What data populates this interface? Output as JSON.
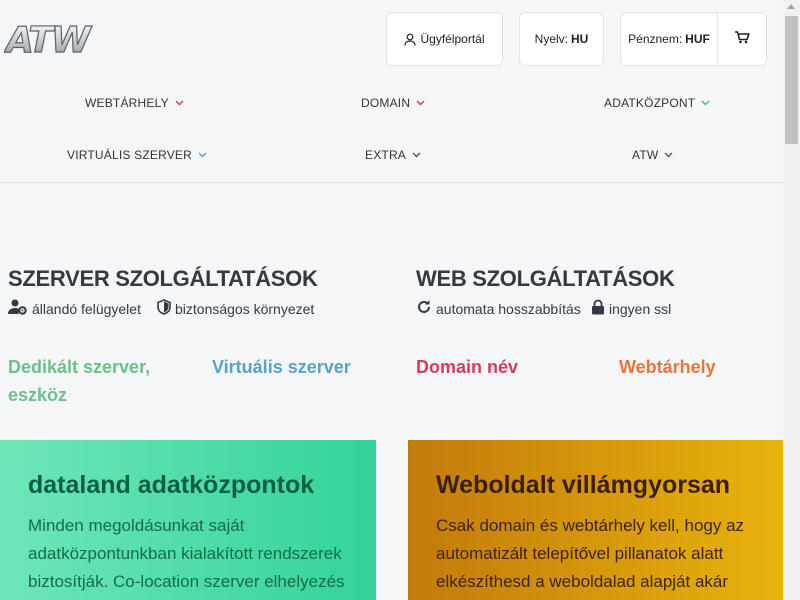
{
  "header": {
    "logo_text": "ATW",
    "portal_label": "Ügyfélportál",
    "language_label": "Nyelv:",
    "language_value": "HU",
    "currency_label": "Pénznem:",
    "currency_value": "HUF"
  },
  "nav": {
    "items": [
      {
        "label": "WEBTÁRHELY",
        "chevron_color": "#d63b5a"
      },
      {
        "label": "DOMAIN",
        "chevron_color": "#d63b5a"
      },
      {
        "label": "ADATKÖZPONT",
        "chevron_color": "#3fb98b"
      },
      {
        "label": "VIRTUÁLIS SZERVER",
        "chevron_color": "#5aa0c8"
      },
      {
        "label": "EXTRA",
        "chevron_color": "#555555"
      },
      {
        "label": "ATW",
        "chevron_color": "#555555"
      }
    ]
  },
  "server_services": {
    "title": "SZERVER SZOLGÁLTATÁSOK",
    "features": [
      {
        "icon": "user-gear-icon",
        "label": "állandó felügyelet"
      },
      {
        "icon": "shield-icon",
        "label": "biztonságos környezet"
      }
    ],
    "links": [
      {
        "label": "Dedikált szerver, eszköz",
        "color": "#6fbf8a"
      },
      {
        "label": "Virtuális szerver",
        "color": "#5aa0c8"
      }
    ]
  },
  "web_services": {
    "title": "WEB SZOLGÁLTATÁSOK",
    "features": [
      {
        "icon": "refresh-icon",
        "label": "automata hosszabbítás"
      },
      {
        "icon": "lock-icon",
        "label": "ingyen ssl"
      }
    ],
    "links": [
      {
        "label": "Domain név",
        "color": "#d63b5a"
      },
      {
        "label": "Webtárhely",
        "color": "#e8743b"
      }
    ]
  },
  "cards": {
    "datacenter": {
      "title": "dataland adatközpontok",
      "body": "Minden megoldásunkat saját adatközpontunkban kialakított rendszerek biztosítják. Co-location szerver elhelyezés"
    },
    "website": {
      "title": "Weboldalt villámgyorsan",
      "body": "Csak domain és webtárhely kell, hogy az automatizált telepítővel pillanatok alatt elkészíthesd a weboldalad alapját akár"
    }
  },
  "colors": {
    "accent_green": "#34d399",
    "accent_gold": "#e8b40c"
  }
}
